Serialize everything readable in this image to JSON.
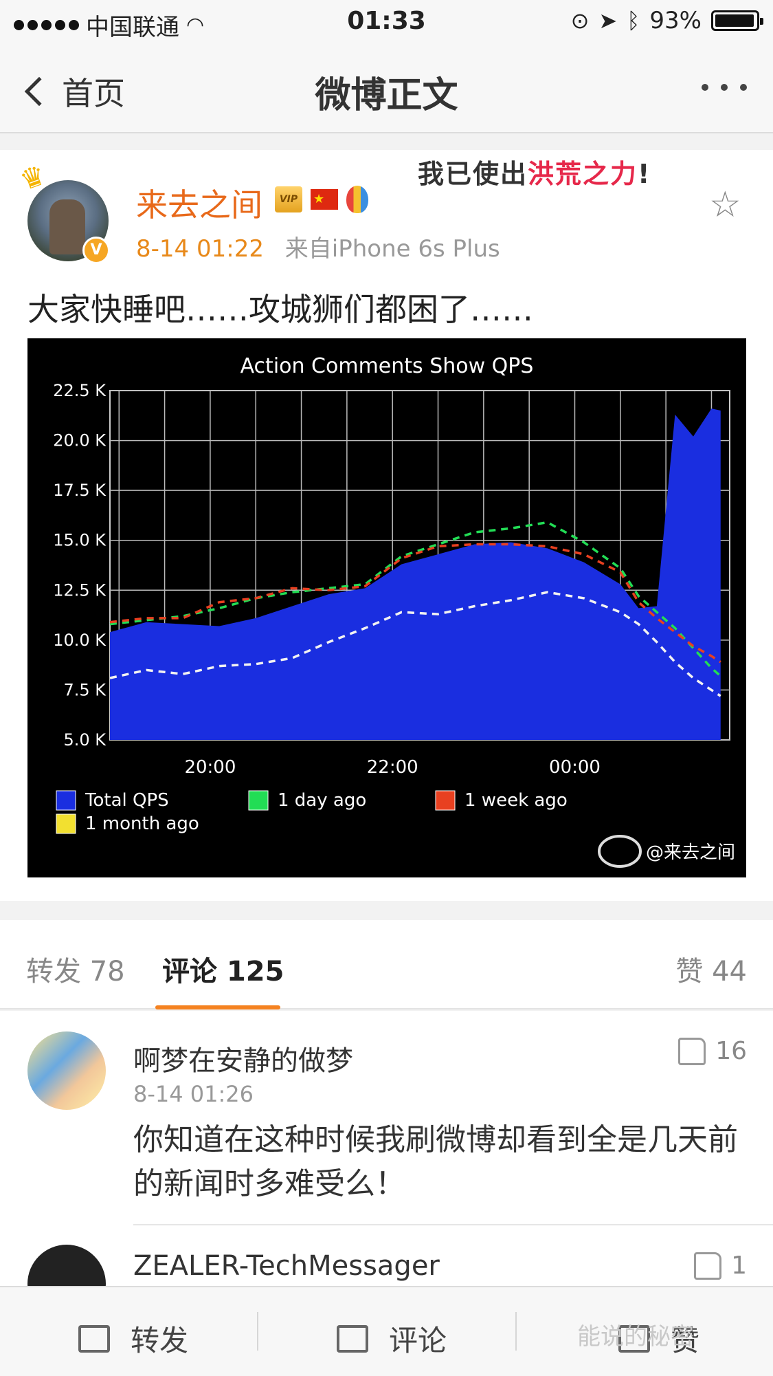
{
  "status_bar": {
    "carrier": "中国联通",
    "time": "01:33",
    "battery_percent": "93%"
  },
  "nav": {
    "back_label": "首页",
    "title": "微博正文"
  },
  "post": {
    "username": "来去之间",
    "badge_vip_text": "VIP",
    "timestamp": "8-14 01:22",
    "source": "来自iPhone 6s Plus",
    "sticker_text_1": "我已使出",
    "sticker_text_2": "洪荒之力",
    "sticker_text_3": "!",
    "text": "大家快睡吧……攻城狮们都困了……",
    "verified_badge": "V"
  },
  "chart_data": {
    "type": "area",
    "title": "Action Comments Show QPS",
    "x_tick_labels": [
      "20:00",
      "22:00",
      "00:00"
    ],
    "y_tick_labels": [
      "22.5 K",
      "20.0 K",
      "17.5 K",
      "15.0 K",
      "12.5 K",
      "10.0 K",
      "7.5 K",
      "5.0 K"
    ],
    "ylim": [
      5.0,
      22.5
    ],
    "grid": true,
    "legend_position": "bottom",
    "legend": [
      {
        "label": "Total QPS",
        "color": "#1a2ee0"
      },
      {
        "label": "1 day ago",
        "color": "#22dd55"
      },
      {
        "label": "1 week ago",
        "color": "#e84020"
      },
      {
        "label": "1 month ago",
        "color": "#f2e030"
      }
    ],
    "x_hours": [
      18.9,
      19.3,
      19.7,
      20.1,
      20.5,
      20.9,
      21.3,
      21.7,
      22.1,
      22.5,
      22.9,
      23.3,
      23.7,
      24.1,
      24.5,
      24.7,
      24.9,
      25.1,
      25.3,
      25.5,
      25.6
    ],
    "series": [
      {
        "name": "Total QPS",
        "values": [
          10.4,
          10.9,
          10.8,
          10.7,
          11.1,
          11.7,
          12.3,
          12.6,
          13.8,
          14.3,
          14.8,
          14.9,
          14.6,
          13.9,
          12.8,
          11.6,
          11.7,
          21.3,
          20.2,
          21.6,
          21.5
        ]
      },
      {
        "name": "1 day ago",
        "values": [
          10.8,
          11.0,
          11.2,
          11.6,
          12.1,
          12.4,
          12.6,
          12.8,
          14.2,
          14.8,
          15.4,
          15.6,
          15.9,
          14.9,
          13.6,
          12.2,
          11.4,
          10.6,
          9.6,
          8.6,
          8.2
        ]
      },
      {
        "name": "1 week ago",
        "values": [
          10.9,
          11.1,
          11.1,
          11.9,
          12.1,
          12.6,
          12.5,
          12.7,
          14.1,
          14.7,
          14.8,
          14.8,
          14.7,
          14.3,
          13.4,
          11.9,
          11.1,
          10.4,
          9.7,
          9.2,
          8.9
        ]
      },
      {
        "name": "1 month ago",
        "values": [
          8.1,
          8.5,
          8.3,
          8.7,
          8.8,
          9.1,
          9.9,
          10.6,
          11.4,
          11.3,
          11.7,
          12.0,
          12.4,
          12.1,
          11.4,
          10.8,
          9.9,
          8.9,
          8.1,
          7.5,
          7.2
        ]
      }
    ],
    "watermark": "@来去之间"
  },
  "tabs": {
    "forward_label": "转发 78",
    "comments_label": "评论 125",
    "likes_label": "赞 44"
  },
  "comments": [
    {
      "name": "啊梦在安静的做梦",
      "time": "8-14 01:26",
      "text": "你知道在这种时候我刷微博却看到全是几天前的新闻时多难受么！",
      "likes": "16"
    },
    {
      "name": "ZEALER-TechMessager",
      "likes": "1"
    }
  ],
  "bottom_bar": {
    "forward_label": "转发",
    "comment_label": "评论",
    "like_label": "赞"
  },
  "watermark_text": "能说的秘密"
}
